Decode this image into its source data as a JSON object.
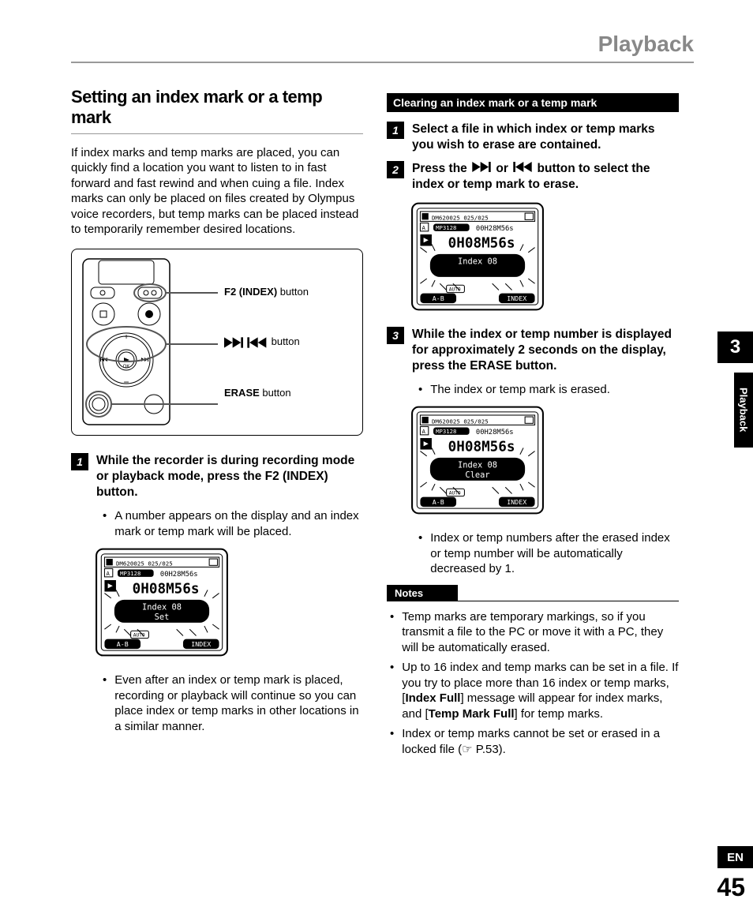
{
  "header": {
    "title": "Playback"
  },
  "chapter_tab": "3",
  "section_tab": "Playback",
  "lang_tab": "EN",
  "page_number": "45",
  "left": {
    "heading": "Setting an index mark or a temp mark",
    "intro": "If index marks and temp marks are placed, you can quickly find a location you want to listen to in fast forward and fast rewind and when cuing a file. Index marks can only be placed on files created by Olympus voice recorders, but temp marks can be placed instead to temporarily remember desired locations.",
    "diagram": {
      "label1_bold": "F2 (INDEX)",
      "label1_thin": " button",
      "label2_thin": " button",
      "label3_bold": "ERASE",
      "label3_thin": " button"
    },
    "step1": {
      "num": "1",
      "text": "While the recorder is during recording mode or playback mode, press the F2 (INDEX) button."
    },
    "bullet1": "A number appears on the display and an index mark or temp mark will be placed.",
    "screen1": {
      "title": "DM620025 025/025",
      "format": "MP3128",
      "time_total": "00H28M56s",
      "time_display": "0H08M56s",
      "msg_line1": "Index 08",
      "msg_line2": "Set",
      "btn_left": "A-B",
      "btn_right": "INDEX"
    },
    "bullet2": "Even after an index or temp mark is placed, recording or playback will continue so you can place index or temp marks in other locations in a similar manner."
  },
  "right": {
    "clearing_heading": "Clearing an index mark or a temp mark",
    "step1": {
      "num": "1",
      "text": "Select a file in which index or temp marks you wish to erase are contained."
    },
    "step2": {
      "num": "2",
      "prefix": "Press the ",
      "middle": " or ",
      "suffix": " button to select the index or temp mark to erase."
    },
    "screen2": {
      "title": "DM620025 025/025",
      "format": "MP3128",
      "time_total": "00H28M56s",
      "time_display": "0H08M56s",
      "msg_line1": "Index 08",
      "msg_line2": "",
      "btn_left": "A-B",
      "btn_right": "INDEX"
    },
    "step3": {
      "num": "3",
      "prefix": "While the index or temp number is displayed for approximately 2 seconds on the display, press the ",
      "bold": "ERASE",
      "suffix": " button."
    },
    "bullet1": "The index or temp mark is erased.",
    "screen3": {
      "title": "DM620025 025/025",
      "format": "MP3128",
      "time_total": "00H28M56s",
      "time_display": "0H08M56s",
      "msg_line1": "Index 08",
      "msg_line2": "Clear",
      "btn_left": "A-B",
      "btn_right": "INDEX"
    },
    "bullet2": "Index or temp numbers after the erased index or temp number will be automatically decreased by 1.",
    "notes_heading": "Notes",
    "note1": "Temp marks are temporary markings, so if you transmit a file to the PC or move it with a PC, they will be automatically erased.",
    "note2_a": "Up to 16 index and temp marks can be set in a file. If you try to place more than 16 index or temp marks, [",
    "note2_b1": "Index Full",
    "note2_c": "] message will appear for index marks, and [",
    "note2_b2": "Temp Mark Full",
    "note2_d": "] for temp marks.",
    "note3": "Index or temp marks cannot be set or erased in a locked file (☞ P.53)."
  }
}
